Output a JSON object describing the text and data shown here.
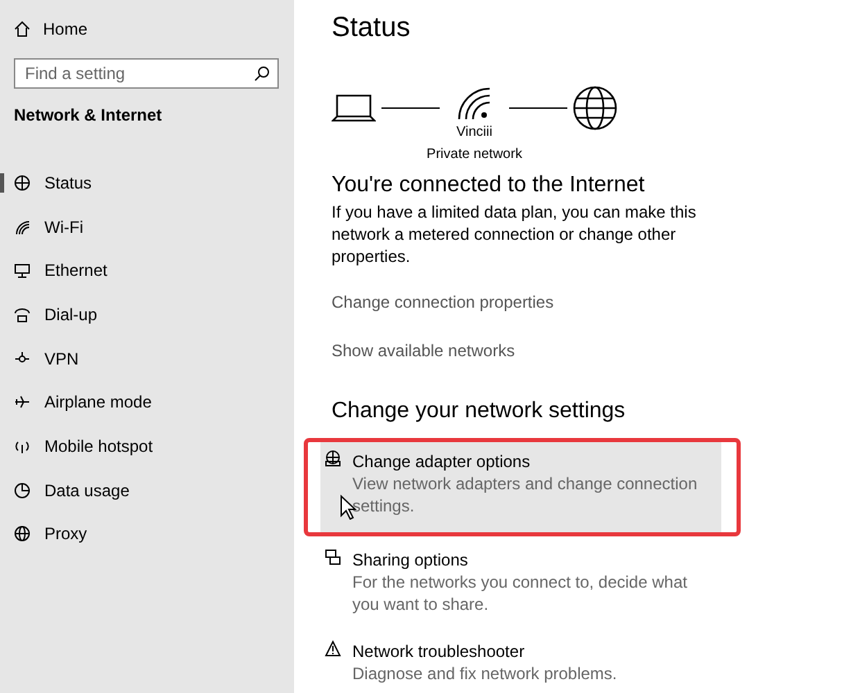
{
  "sidebar": {
    "home": "Home",
    "search": {
      "placeholder": "Find a setting"
    },
    "section": "Network & Internet",
    "items": [
      {
        "label": "Status",
        "selected": true
      },
      {
        "label": "Wi-Fi",
        "selected": false
      },
      {
        "label": "Ethernet",
        "selected": false
      },
      {
        "label": "Dial-up",
        "selected": false
      },
      {
        "label": "VPN",
        "selected": false
      },
      {
        "label": "Airplane mode",
        "selected": false
      },
      {
        "label": "Mobile hotspot",
        "selected": false
      },
      {
        "label": "Data usage",
        "selected": false
      },
      {
        "label": "Proxy",
        "selected": false
      }
    ]
  },
  "main": {
    "title": "Status",
    "network": {
      "name": "Vinciii",
      "type": "Private network"
    },
    "connection_heading": "You're connected to the Internet",
    "connection_text": "If you have a limited data plan, you can make this network a metered connection or change other properties.",
    "links": [
      "Change connection properties",
      "Show available networks"
    ],
    "settings_heading": "Change your network settings",
    "settings": [
      {
        "title": "Change adapter options",
        "description": "View network adapters and change connection settings.",
        "hovered": true,
        "outlined": true
      },
      {
        "title": "Sharing options",
        "description": "For the networks you connect to, decide what you want to share.",
        "hovered": false,
        "outlined": false
      },
      {
        "title": "Network troubleshooter",
        "description": "Diagnose and fix network problems.",
        "hovered": false,
        "outlined": false
      }
    ]
  }
}
